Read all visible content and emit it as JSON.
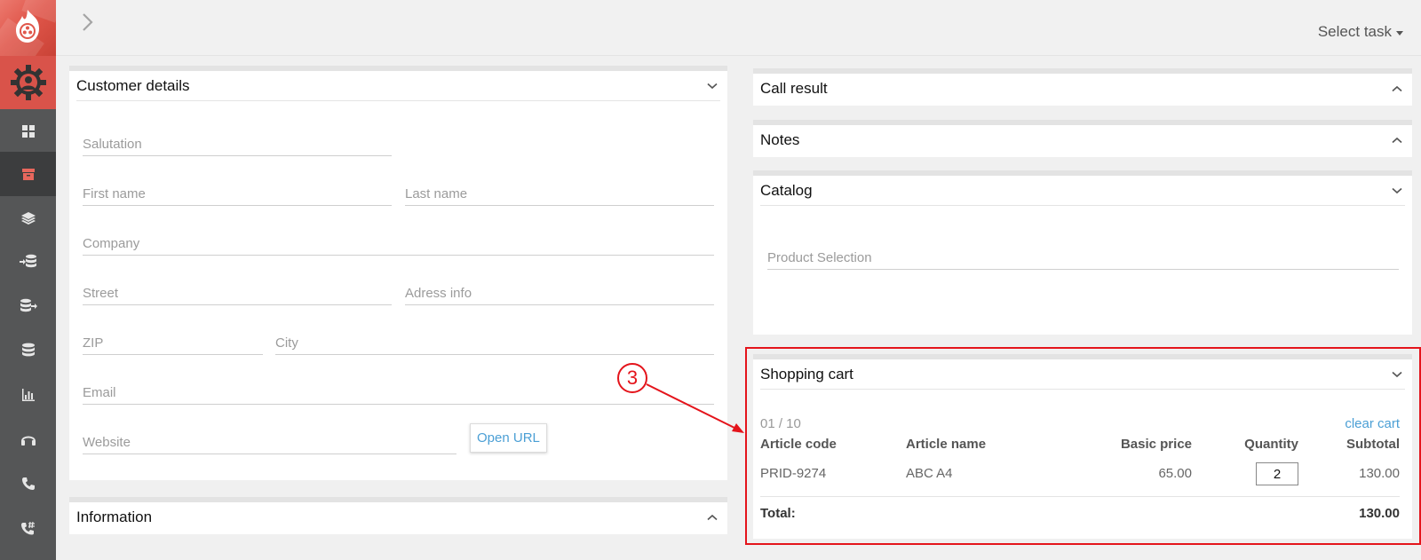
{
  "topbar": {
    "select_task_label": "Select task"
  },
  "customer_details": {
    "title": "Customer details",
    "fields": {
      "salutation": "Salutation",
      "first_name": "First name",
      "last_name": "Last name",
      "company": "Company",
      "street": "Street",
      "address_info": "Adress info",
      "zip": "ZIP",
      "city": "City",
      "email": "Email",
      "website": "Website"
    },
    "open_url_label": "Open URL"
  },
  "information": {
    "title": "Information"
  },
  "call_result": {
    "title": "Call result"
  },
  "notes": {
    "title": "Notes"
  },
  "catalog": {
    "title": "Catalog",
    "product_selection_placeholder": "Product Selection"
  },
  "shopping_cart": {
    "title": "Shopping cart",
    "count": "01 / 10",
    "clear_label": "clear cart",
    "columns": {
      "article_code": "Article code",
      "article_name": "Article name",
      "basic_price": "Basic price",
      "quantity": "Quantity",
      "subtotal": "Subtotal"
    },
    "rows": [
      {
        "article_code": "PRID-9274",
        "article_name": "ABC A4",
        "basic_price": "65.00",
        "quantity": "2",
        "subtotal": "130.00"
      }
    ],
    "total_label": "Total:",
    "total_value": "130.00"
  },
  "annotation": {
    "number": "3",
    "color": "#e4141b"
  },
  "colors": {
    "brand": "#e0564a",
    "sidebar": "#555657",
    "link": "#4b9fd5"
  },
  "sidebar": {
    "items": [
      {
        "icon": "dashboard-icon"
      },
      {
        "icon": "archive-icon"
      },
      {
        "icon": "layers-icon"
      },
      {
        "icon": "database-import-icon"
      },
      {
        "icon": "database-export-icon"
      },
      {
        "icon": "database-icon"
      },
      {
        "icon": "bar-chart-icon"
      },
      {
        "icon": "headset-icon"
      },
      {
        "icon": "phone-icon"
      },
      {
        "icon": "phone-hash-icon"
      }
    ]
  }
}
